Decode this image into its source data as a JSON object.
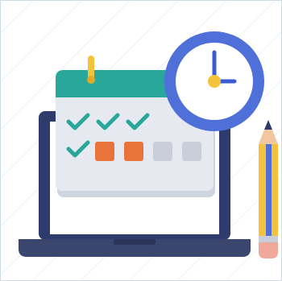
{
  "illustration": {
    "subject": "schedule-planning-icon",
    "elements": {
      "laptop": "laptop-icon",
      "calendar": "calendar-icon",
      "clock": "clock-icon",
      "pencil": "pencil-icon"
    },
    "colors": {
      "laptop_body": "#2f3b6d",
      "laptop_screen": "#ffffff",
      "laptop_base": "#3a466e",
      "calendar_header": "#2aa79b",
      "calendar_body": "#e6e9ef",
      "calendar_pin": "#f5c33b",
      "check": "#2aa79b",
      "orange_box": "#e8743b",
      "gray_box": "#c9ced9",
      "clock_ring": "#4f6fd9",
      "clock_face": "#ffffff",
      "clock_hands": "#3d5bd0",
      "clock_center": "#f5c33b",
      "pencil_body": "#f5c33b",
      "pencil_stripe": "#4f6fd9",
      "pencil_tip": "#f0a89b",
      "pencil_lead": "#2f3b6d"
    },
    "calendar_rows": [
      [
        "check",
        "check",
        "check"
      ],
      [
        "check",
        "orange",
        "orange",
        "gray",
        "gray"
      ]
    ]
  }
}
